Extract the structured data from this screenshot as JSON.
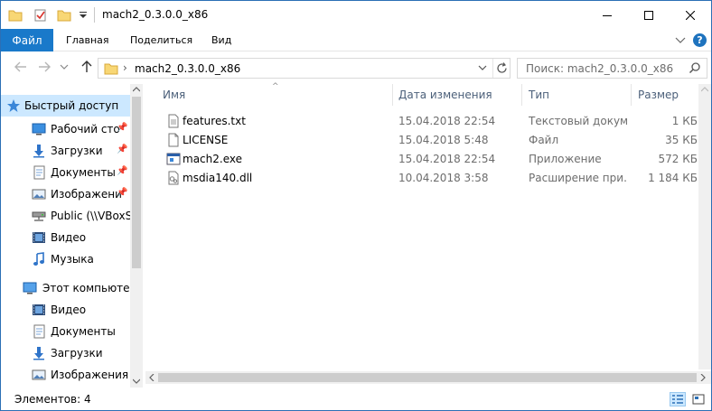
{
  "window": {
    "title": "mach2_0.3.0.0_x86"
  },
  "ribbon": {
    "tabs": [
      {
        "label": "Файл"
      },
      {
        "label": "Главная"
      },
      {
        "label": "Поделиться"
      },
      {
        "label": "Вид"
      }
    ],
    "help_label": "?"
  },
  "address": {
    "separator": "›",
    "path": "mach2_0.3.0.0_x86"
  },
  "search": {
    "placeholder": "Поиск: mach2_0.3.0.0_x86"
  },
  "navigation": {
    "items": [
      {
        "label": "Быстрый доступ",
        "icon": "star-icon",
        "pinned": false,
        "selected": true
      },
      {
        "label": "Рабочий сто",
        "icon": "desktop-icon",
        "pinned": true
      },
      {
        "label": "Загрузки",
        "icon": "download-icon",
        "pinned": true
      },
      {
        "label": "Документы",
        "icon": "documents-icon",
        "pinned": true
      },
      {
        "label": "Изображени",
        "icon": "pictures-icon",
        "pinned": true
      },
      {
        "label": "Public (\\\\VBoxSv",
        "icon": "network-drive-icon",
        "pinned": false
      },
      {
        "label": "Видео",
        "icon": "video-icon",
        "pinned": false
      },
      {
        "label": "Музыка",
        "icon": "music-icon",
        "pinned": false
      },
      {
        "label": "Этот компьютер",
        "icon": "computer-icon",
        "pinned": false
      },
      {
        "label": "Видео",
        "icon": "video-icon",
        "pinned": false
      },
      {
        "label": "Документы",
        "icon": "documents-icon",
        "pinned": false
      },
      {
        "label": "Загрузки",
        "icon": "download-icon",
        "pinned": false
      },
      {
        "label": "Изображения",
        "icon": "pictures-icon",
        "pinned": false
      }
    ]
  },
  "files": {
    "columns": [
      {
        "label": "Имя"
      },
      {
        "label": "Дата изменения"
      },
      {
        "label": "Тип"
      },
      {
        "label": "Размер"
      }
    ],
    "sort_arrow": "^",
    "rows": [
      {
        "name": "features.txt",
        "date": "15.04.2018 22:54",
        "type": "Текстовый докум...",
        "size": "1 КБ",
        "icon": "text-file-icon"
      },
      {
        "name": "LICENSE",
        "date": "15.04.2018 5:48",
        "type": "Файл",
        "size": "35 КБ",
        "icon": "file-icon"
      },
      {
        "name": "mach2.exe",
        "date": "15.04.2018 22:54",
        "type": "Приложение",
        "size": "572 КБ",
        "icon": "exe-icon"
      },
      {
        "name": "msdia140.dll",
        "date": "10.04.2018 3:58",
        "type": "Расширение при...",
        "size": "1 184 КБ",
        "icon": "dll-icon"
      }
    ]
  },
  "status": {
    "items_count": "Элементов: 4"
  },
  "colors": {
    "accent": "#1979ca",
    "selection": "#cce8ff",
    "header_text": "#4c607a",
    "meta_text": "#6d6d6d"
  }
}
